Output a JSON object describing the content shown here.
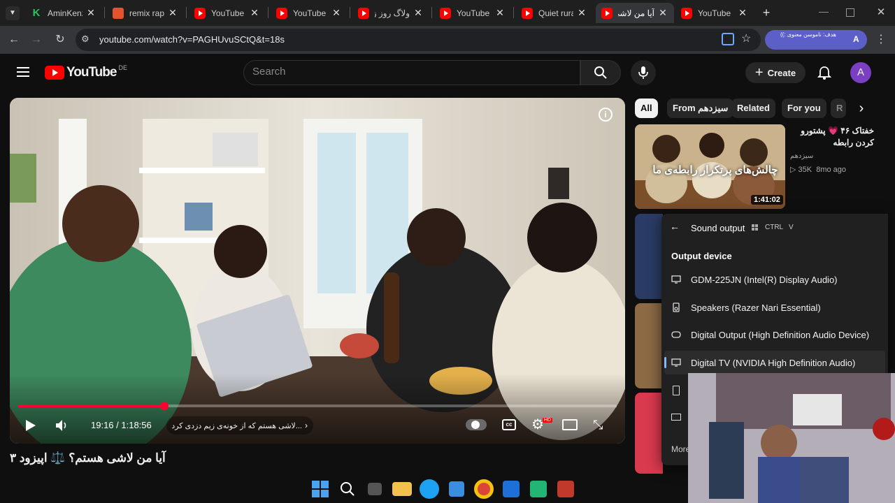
{
  "browser": {
    "tabs": [
      {
        "title": "AminKenzi",
        "favicon": "k-icon"
      },
      {
        "title": "remix rap",
        "favicon": "remix-icon"
      },
      {
        "title": "YouTube",
        "favicon": "youtube-icon"
      },
      {
        "title": "YouTube",
        "favicon": "youtube-icon"
      },
      {
        "title": "ولاگ روز زا",
        "favicon": "youtube-icon"
      },
      {
        "title": "YouTube",
        "favicon": "youtube-icon"
      },
      {
        "title": "Quiet rural",
        "favicon": "youtube-icon"
      },
      {
        "title": "آیا من لاشی",
        "favicon": "youtube-icon"
      },
      {
        "title": "YouTube",
        "favicon": "youtube-icon"
      }
    ],
    "active_tab_index": 7,
    "url": "youtube.com/watch?v=PAGHUvuSCtQ&t=18s",
    "profile_letter": "A",
    "profile_banner_text": "هدف: ناموسن معنوی :))"
  },
  "youtube": {
    "logo_text": "YouTube",
    "region": "DE",
    "search_placeholder": "Search",
    "create_label": "Create",
    "avatar_letter": "A"
  },
  "player": {
    "time": "19:16 / 1:18:56",
    "chapter": "...لاشی هستم که از خونه‌ی زیم دزدی کرده",
    "progress": 0.244,
    "hd_badge": "HD"
  },
  "video": {
    "title": "آیا من لاشی هستم؟ ⚖️ اپیزود ۳"
  },
  "chips": [
    {
      "label": "All",
      "active": true
    },
    {
      "label": "From سیزدهم",
      "active": false
    },
    {
      "label": "Related",
      "active": false
    },
    {
      "label": "For you",
      "active": false
    },
    {
      "label": "R",
      "active": false
    }
  ],
  "recommended": [
    {
      "title_line1": "خفتاک ۴۶ 💗 پشتورو",
      "title_line2": "کردن رابطه",
      "channel": "سیزدهم",
      "views": "35K",
      "age": "8mo ago",
      "duration": "1:41:02",
      "thumb_text": "چالش‌های پرتکرار رابطه‌ی ما"
    }
  ],
  "sound_panel": {
    "title": "Sound output",
    "shortcut_key1": "CTRL",
    "shortcut_key2": "V",
    "section": "Output device",
    "devices": [
      {
        "label": "GDM-225JN (Intel(R) Display Audio)",
        "icon": "monitor-icon"
      },
      {
        "label": "Speakers (Razer Nari Essential)",
        "icon": "speaker-icon"
      },
      {
        "label": "Digital Output (High Definition Audio Device)",
        "icon": "digital-output-icon"
      },
      {
        "label": "Digital TV (NVIDIA High Definition Audio)",
        "icon": "monitor-icon"
      }
    ],
    "more_label": "More"
  },
  "colors": {
    "youtube_red": "#ff0000",
    "progress_red": "#ff0033",
    "panel_bg": "#202020"
  }
}
